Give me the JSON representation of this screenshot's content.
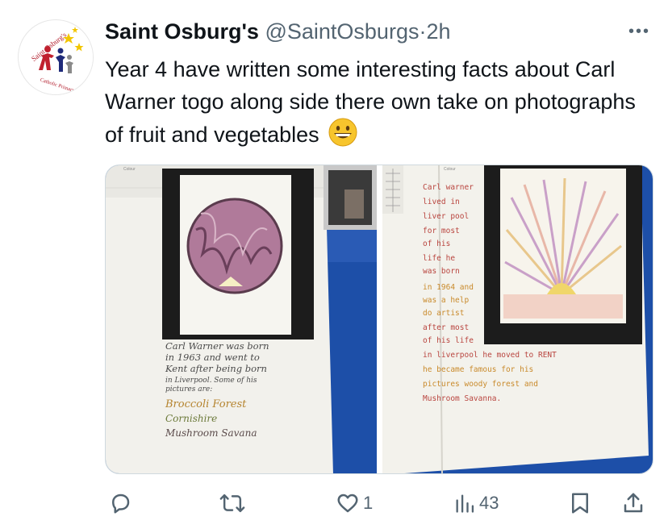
{
  "tweet": {
    "author_name": "Saint Osburg's",
    "handle": "@SaintOsburgs",
    "separator": "·",
    "time": "2h",
    "more_label": "•••",
    "text": "Year 4 have written some interesting facts about Carl Warner togo along side there own take on photographs of fruit and vegetables",
    "emoji": "grinning-face-emoji"
  },
  "avatar": {
    "logo_text_top": "Saint Osburg's",
    "logo_text_bottom": "Catholic Primary School"
  },
  "media": {
    "left_photo": {
      "lines": [
        "Carl Warner was born",
        "in 1963 and went to",
        "Kent after being born",
        "in Liverpool. Some of his",
        "pictures are:",
        "Broccoli Forest",
        "Cornishire",
        "Mushroom Savana"
      ],
      "label_corner": "Colour"
    },
    "right_photo": {
      "column_lines": [
        "Carl warner",
        "lived in",
        "liver pool",
        "for most",
        "of his",
        "life he",
        "was born",
        "in 1964 and",
        "was a help",
        "do artist",
        "after most",
        "of his life"
      ],
      "bottom_lines": [
        "in liverpool he moved to RENT",
        "he became famous for his",
        "pictures woody forest and",
        "Mushroom Savanna."
      ],
      "label_corner": "Colour"
    }
  },
  "actions": {
    "reply_icon": "reply-icon",
    "retweet_icon": "retweet-icon",
    "like_icon": "like-icon",
    "like_count": "1",
    "views_icon": "views-icon",
    "views_count": "43",
    "bookmark_icon": "bookmark-icon",
    "share_icon": "share-icon"
  },
  "colors": {
    "text_primary": "#0f1419",
    "text_secondary": "#536471",
    "desk_blue": "#1d4fa8",
    "frame_black": "#1e1e1e",
    "paper": "#f4f3ee",
    "divider": "#cfd9de"
  }
}
